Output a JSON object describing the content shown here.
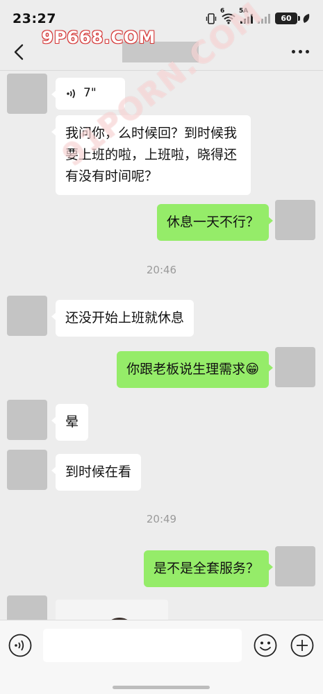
{
  "status_bar": {
    "time": "23:27",
    "network": "6",
    "network_2": "5A",
    "battery": "60",
    "icons": [
      "vibrate-icon",
      "wifi-icon",
      "signal-icon",
      "signal-icon",
      "battery-icon",
      "leaf-icon"
    ]
  },
  "watermark": {
    "top": "9P668.COM",
    "diagonal": "91PORN.COM"
  },
  "nav": {
    "icons": [
      "back-arrow-icon",
      "more-dots-icon"
    ]
  },
  "messages": {
    "voice_duration": "7\"",
    "msg1": "我问你，么时候回？到时候我要上班的啦，上班啦，晓得还有没有时间呢？",
    "msg2": "休息一天不行？",
    "time1": "20:46",
    "msg3": "还没开始上班就休息",
    "msg4": "你跟老板说生理需求",
    "msg4_emoji": "😁",
    "msg5": "晕",
    "msg6": "到时候在看",
    "time2": "20:49",
    "msg7": "是不是全套服务？"
  },
  "input_bar": {
    "icons": [
      "voice-input-icon",
      "emoji-icon",
      "plus-icon"
    ]
  },
  "colors": {
    "background": "#ededed",
    "incoming_bubble": "#ffffff",
    "outgoing_bubble": "#95ec69",
    "watermark_red": "#d63a3a"
  }
}
